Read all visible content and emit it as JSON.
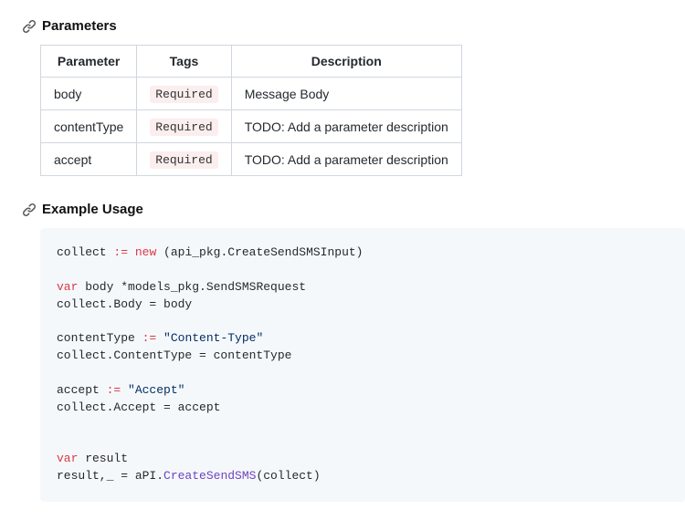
{
  "parameters": {
    "heading": "Parameters",
    "columns": {
      "param": "Parameter",
      "tags": "Tags",
      "desc": "Description"
    },
    "rows": [
      {
        "param": "body",
        "tag": "Required",
        "desc": "Message Body"
      },
      {
        "param": "contentType",
        "tag": "Required",
        "desc": "TODO: Add a parameter description"
      },
      {
        "param": "accept",
        "tag": "Required",
        "desc": "TODO: Add a parameter description"
      }
    ]
  },
  "example": {
    "heading": "Example Usage",
    "code": {
      "l1a": "collect ",
      "l1op": ":=",
      "l1b": " ",
      "l1kw": "new",
      "l1c": " (api_pkg.CreateSendSMSInput)",
      "l2kw": "var",
      "l2a": " body *models_pkg.SendSMSRequest",
      "l3": "collect.Body = body",
      "l4a": "contentType ",
      "l4op": ":=",
      "l4b": " ",
      "l4str": "\"Content-Type\"",
      "l5": "collect.ContentType = contentType",
      "l6a": "accept ",
      "l6op": ":=",
      "l6b": " ",
      "l6str": "\"Accept\"",
      "l7": "collect.Accept = accept",
      "l8kw": "var",
      "l8a": " result",
      "l9a": "result,_ = aPI.",
      "l9fn": "CreateSendSMS",
      "l9b": "(collect)"
    }
  }
}
